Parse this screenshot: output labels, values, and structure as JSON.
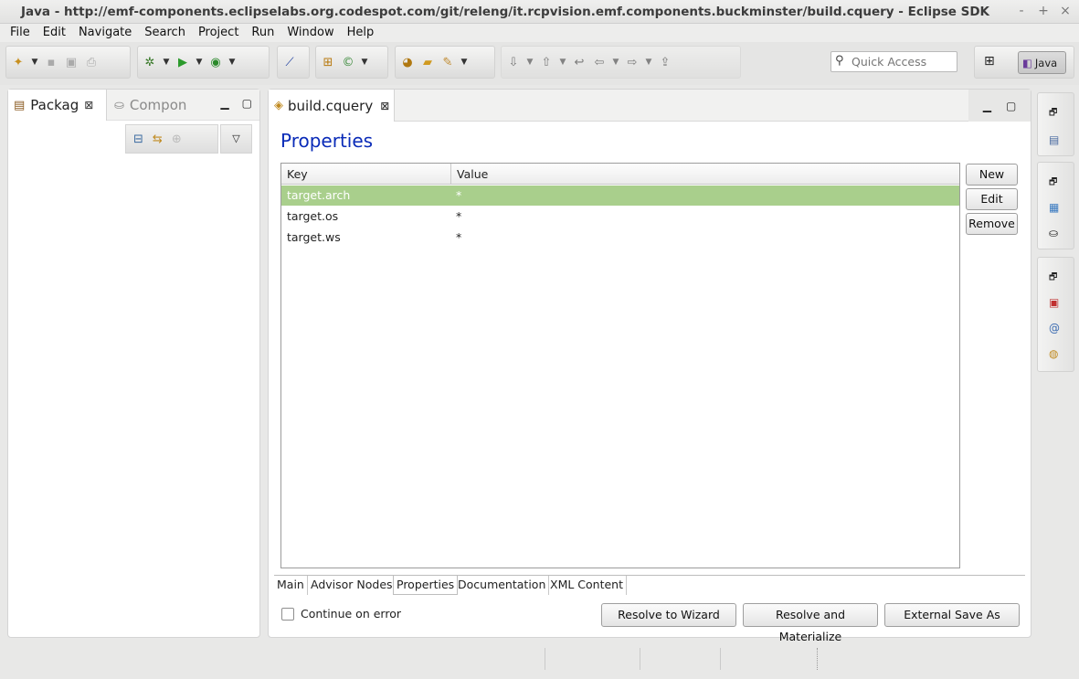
{
  "window": {
    "title": "Java - http://emf-components.eclipselabs.org.codespot.com/git/releng/it.rcpvision.emf.components.buckminster/build.cquery - Eclipse SDK",
    "controls": [
      "-",
      "+",
      "×"
    ]
  },
  "menu": [
    "File",
    "Edit",
    "Navigate",
    "Search",
    "Project",
    "Run",
    "Window",
    "Help"
  ],
  "toolbar": {
    "quick_access_placeholder": "Quick Access",
    "perspective_label": "Java"
  },
  "left_panel": {
    "tabs": [
      {
        "label": "Packag",
        "icon": "package-explorer-icon",
        "active": true
      },
      {
        "label": "Compon",
        "icon": "component-explorer-icon",
        "active": false
      }
    ]
  },
  "editor": {
    "tab_label": "build.cquery",
    "section_title": "Properties",
    "table": {
      "columns": [
        "Key",
        "Value"
      ],
      "rows": [
        {
          "key": "target.arch",
          "value": "*",
          "selected": true
        },
        {
          "key": "target.os",
          "value": "*",
          "selected": false
        },
        {
          "key": "target.ws",
          "value": "*",
          "selected": false
        }
      ]
    },
    "side_buttons": [
      "New",
      "Edit",
      "Remove"
    ],
    "page_tabs": [
      {
        "label": "Main",
        "active": false
      },
      {
        "label": "Advisor Nodes",
        "active": false
      },
      {
        "label": "Properties",
        "active": true
      },
      {
        "label": "Documentation",
        "active": false
      },
      {
        "label": "XML Content",
        "active": false
      }
    ],
    "continue_on_error_label": "Continue on error",
    "continue_on_error_checked": false,
    "bottom_buttons": [
      "Resolve to Wizard",
      "Resolve and Materialize",
      "External Save As"
    ]
  },
  "colors": {
    "selected_row": "#a9cf8c",
    "section_title": "#0a2bb8"
  }
}
